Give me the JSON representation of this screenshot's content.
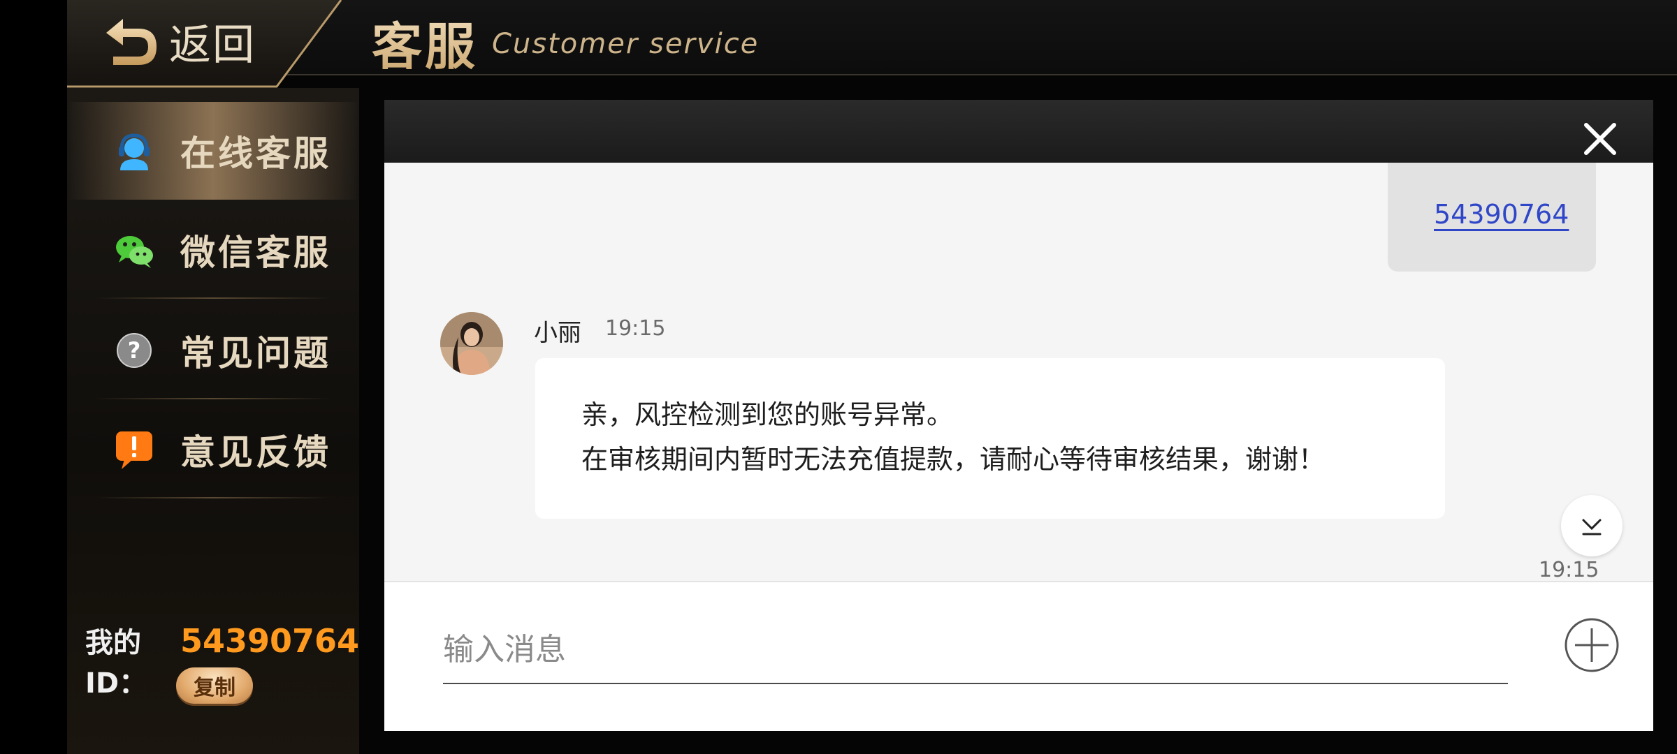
{
  "header": {
    "back_label": "返回",
    "title_cn": "客服",
    "title_en": "Customer service"
  },
  "sidebar": {
    "items": [
      {
        "label": "在线客服",
        "icon": "headset-icon",
        "active": true
      },
      {
        "label": "微信客服",
        "icon": "wechat-icon",
        "active": false
      },
      {
        "label": "常见问题",
        "icon": "question-icon",
        "active": false
      },
      {
        "label": "意见反馈",
        "icon": "feedback-icon",
        "active": false
      }
    ],
    "id_label": "我的ID：",
    "id_value": "54390764",
    "copy_label": "复制"
  },
  "chat": {
    "my_message": "54390764",
    "agent_name": "小丽",
    "agent_time": "19:15",
    "agent_message_lines": [
      "亲，风控检测到您的账号异常。",
      "在审核期间内暂时无法充值提款，请耐心等待审核结果，谢谢！"
    ],
    "bottom_time": "19:15",
    "input_placeholder": "输入消息"
  },
  "colors": {
    "accent_gold": "#e8cfa2",
    "id_orange": "#ff9a1f",
    "link_blue": "#2f46c8"
  }
}
